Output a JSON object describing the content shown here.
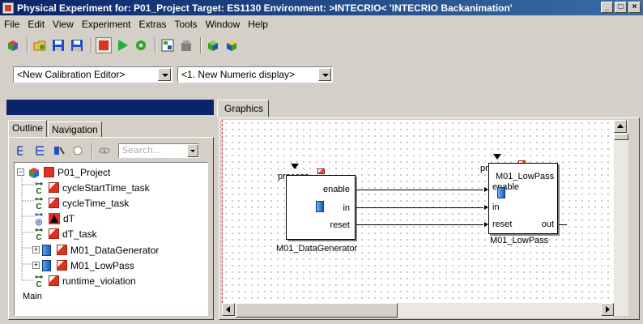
{
  "window": {
    "title": "Physical Experiment for: P01_Project  Target: ES1130  Environment: >INTECRIO<  'INTECRIO Backanimation'",
    "buttons": [
      "_",
      "□",
      "×"
    ]
  },
  "menu": [
    "File",
    "Edit",
    "View",
    "Experiment",
    "Extras",
    "Tools",
    "Window",
    "Help"
  ],
  "toolbar": {
    "icons": [
      "experiment-icon",
      "open-icon",
      "save-icon",
      "save-all-icon",
      "stop-icon",
      "play-icon",
      "settings-icon",
      "layout-icon",
      "database-icon",
      "cube-green-icon",
      "cube-blue-icon"
    ]
  },
  "combos": {
    "calibration_editor": "<New Calibration Editor>",
    "numeric_display": "<1. New Numeric display>"
  },
  "left_panel": {
    "tabs": [
      "Outline",
      "Navigation"
    ],
    "active_tab": "Outline",
    "search_placeholder": "Search...",
    "tree": [
      {
        "label": "P01_Project",
        "kind": "project",
        "expander": "−"
      },
      {
        "label": "cycleStartTime_task",
        "kind": "c-task"
      },
      {
        "label": "cycleTime_task",
        "kind": "c-task"
      },
      {
        "label": "dT",
        "kind": "variable"
      },
      {
        "label": "dT_task",
        "kind": "c-task"
      },
      {
        "label": "M01_DataGenerator",
        "kind": "module",
        "expander": "+"
      },
      {
        "label": "M01_LowPass",
        "kind": "module",
        "expander": "+"
      },
      {
        "label": "runtime_violation",
        "kind": "c-task"
      }
    ],
    "footer": "Main"
  },
  "graphics": {
    "tab_label": "Graphics",
    "block1": {
      "process": "process",
      "ports": [
        "enable",
        "in",
        "reset"
      ],
      "name": "M01_DataGenerator"
    },
    "block2": {
      "process": "process",
      "title": "M01_LowPass",
      "ports": [
        "enable",
        "in",
        "reset"
      ],
      "out": "out",
      "name": "M01_LowPass"
    }
  },
  "colors": {
    "title_bar": "#0a246a",
    "window_bg": "#d4d0c8",
    "accent_red": "#e03020",
    "accent_blue": "#1a5fb4"
  }
}
